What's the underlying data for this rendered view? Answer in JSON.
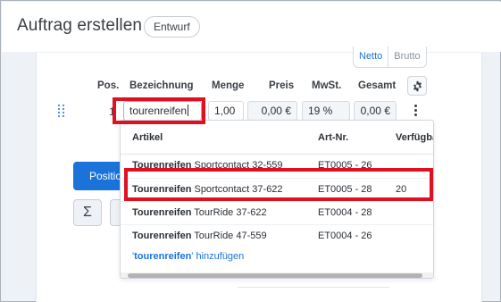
{
  "header": {
    "title": "Auftrag erstellen",
    "status": "Entwurf"
  },
  "price_toggle": {
    "options": [
      "Netto",
      "Brutto"
    ],
    "active": "Netto"
  },
  "table": {
    "columns": {
      "pos": "Pos.",
      "bezeichnung": "Bezeichnung",
      "menge": "Menge",
      "preis": "Preis",
      "mwst": "MwSt.",
      "gesamt": "Gesamt"
    },
    "row": {
      "pos": "1",
      "bezeichnung": "tourenreifen",
      "menge": "1,00",
      "preis": "0,00 €",
      "mwst": "19 %",
      "gesamt": "0,00 €"
    }
  },
  "buttons": {
    "add_position": "Position",
    "sum": "Σ"
  },
  "dropdown": {
    "columns": {
      "artikel": "Artikel",
      "artnr": "Art-Nr.",
      "verfuegbar": "Verfügba"
    },
    "items": [
      {
        "name_bold": "Tourenreifen",
        "name_rest": " Sportcontact 32-559",
        "artnr": "ET0005 - 26",
        "verfuegbar": ""
      },
      {
        "name_bold": "Tourenreifen",
        "name_rest": " Sportcontact 37-622",
        "artnr": "ET0005 - 28",
        "verfuegbar": "20"
      },
      {
        "name_bold": "Tourenreifen",
        "name_rest": " TourRide 37-622",
        "artnr": "ET0004 - 28",
        "verfuegbar": ""
      },
      {
        "name_bold": "Tourenreifen",
        "name_rest": " TourRide 47-559",
        "artnr": "ET0004 - 26",
        "verfuegbar": ""
      }
    ],
    "add_new": {
      "quote_open": "'",
      "term": "tourenreifen",
      "quote_close": "'",
      "suffix": " hinzufügen"
    }
  },
  "colors": {
    "accent": "#1a73d9",
    "highlight": "#e01020"
  },
  "icons": {
    "settings": "gear-icon",
    "drag": "drag-handle-icon",
    "row_menu": "kebab-menu-icon"
  }
}
